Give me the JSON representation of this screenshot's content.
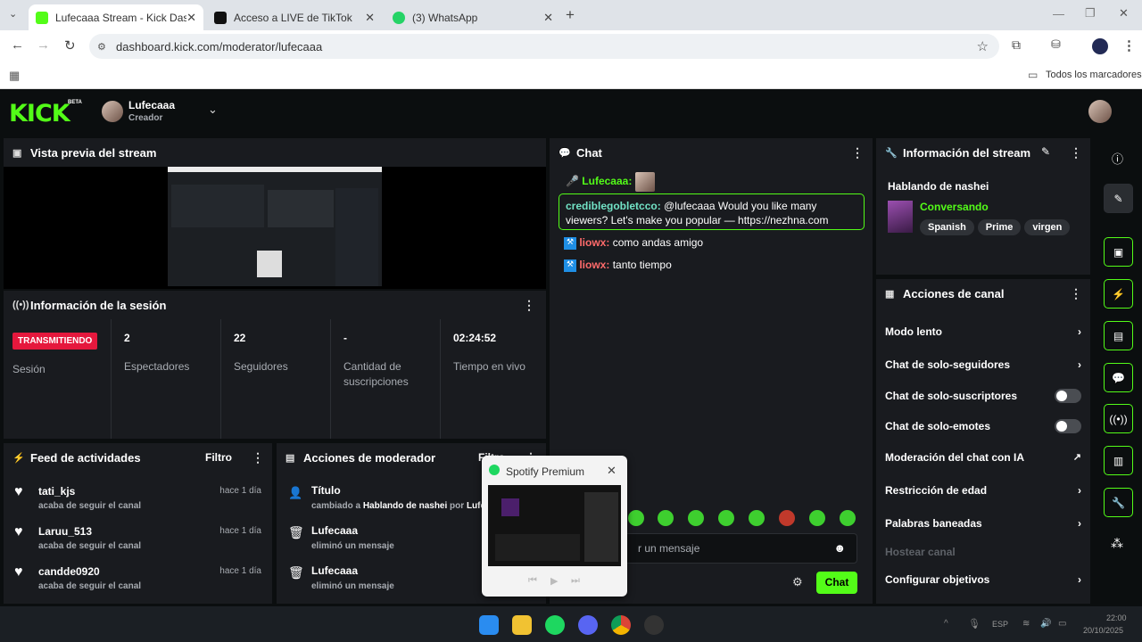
{
  "browser": {
    "tabs": [
      {
        "label": "Lufecaaa Stream - Kick Dashbo",
        "active": true
      },
      {
        "label": "Acceso a LIVE de TikTok",
        "active": false
      },
      {
        "label": "(3) WhatsApp",
        "active": false
      }
    ],
    "url": "dashboard.kick.com/moderator/lufecaaa",
    "bookmarks_label": "Todos los marcadores"
  },
  "header": {
    "logo": "KICK",
    "beta": "BETA",
    "channel_name": "Lufecaaa",
    "role": "Creador"
  },
  "preview": {
    "title": "Vista previa del stream"
  },
  "session": {
    "title": "Información de la sesión",
    "status_badge": "TRANSMITIENDO",
    "status_label": "Sesión",
    "stats": [
      {
        "value": "2",
        "label": "Espectadores"
      },
      {
        "value": "22",
        "label": "Seguidores"
      },
      {
        "value": "-",
        "label": "Cantidad de suscripciones"
      },
      {
        "value": "02:24:52",
        "label": "Tiempo en vivo"
      }
    ]
  },
  "feed": {
    "title": "Feed de actividades",
    "filter": "Filtro",
    "items": [
      {
        "user": "tati_kjs",
        "time": "hace 1 día",
        "text": "acaba de seguir el canal"
      },
      {
        "user": "Laruu_513",
        "time": "hace 1 día",
        "text": "acaba de seguir el canal"
      },
      {
        "user": "candde0920",
        "time": "hace 1 día",
        "text": "acaba de seguir el canal"
      }
    ]
  },
  "modactions": {
    "title": "Acciones de moderador",
    "filter": "Filtro",
    "items": [
      {
        "title": "Título",
        "text_prefix": "cambiado a ",
        "text_bold": "Hablando de nashei",
        "text_mid": " por ",
        "text_user": "Lufecaaa"
      },
      {
        "title": "Lufecaaa",
        "text_prefix": "eliminó un mensaje",
        "text_bold": "",
        "text_mid": "",
        "text_user": ""
      },
      {
        "title": "Lufecaaa",
        "text_prefix": "eliminó un mensaje",
        "text_bold": "",
        "text_mid": "",
        "text_user": ""
      }
    ]
  },
  "chat": {
    "title": "Chat",
    "messages": [
      {
        "user": "Lufecaaa:",
        "text": "",
        "color": "#53fc18"
      },
      {
        "user": "crediblegobletcco:",
        "text": "@lufecaaa Would you like many viewers? Let's make you popular — https://nezhna.com",
        "color": "#72e3c6"
      },
      {
        "user": "liowx:",
        "text": "como andas amigo",
        "color": "#ff6b6b"
      },
      {
        "user": "liowx:",
        "text": "tanto tiempo",
        "color": "#ff6b6b"
      }
    ],
    "input_placeholder": "r un mensaje",
    "send_label": "Chat"
  },
  "stream_info": {
    "title": "Información del stream",
    "stream_title": "Hablando de nashei",
    "category": "Conversando",
    "tags": [
      "Spanish",
      "Prime",
      "virgen"
    ]
  },
  "channel_actions": {
    "title": "Acciones de canal",
    "items": [
      {
        "label": "Modo lento",
        "control": "chevron"
      },
      {
        "label": "Chat de solo-seguidores",
        "control": "chevron"
      },
      {
        "label": "Chat de solo-suscriptores",
        "control": "toggle"
      },
      {
        "label": "Chat de solo-emotes",
        "control": "toggle"
      },
      {
        "label": "Moderación del chat con IA",
        "control": "external"
      },
      {
        "label": "Restricción de edad",
        "control": "chevron"
      },
      {
        "label": "Palabras baneadas",
        "control": "chevron"
      },
      {
        "label": "Hostear canal",
        "control": "disabled"
      },
      {
        "label": "Configurar objetivos",
        "control": "chevron"
      }
    ]
  },
  "spotify_popup": {
    "title": "Spotify Premium"
  },
  "taskbar": {
    "lang": "ESP",
    "time": "22:00",
    "date": "20/10/2025"
  },
  "colors": {
    "accent": "#53fc18",
    "badge_red": "#e5183d",
    "panel": "#191b1f",
    "background": "#0b0e0f"
  }
}
